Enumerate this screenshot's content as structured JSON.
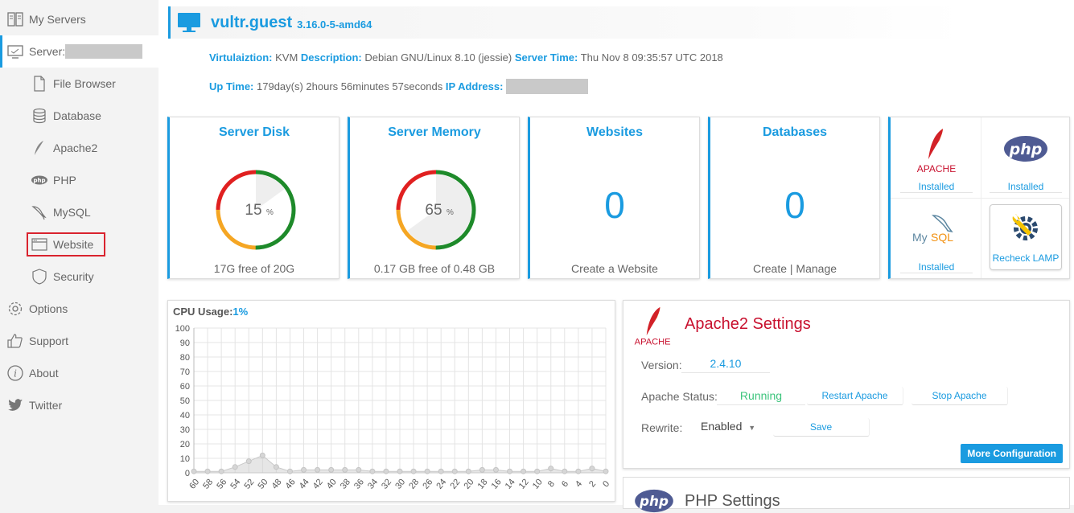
{
  "sidebar": {
    "my_servers": "My Servers",
    "server_label": "Server:",
    "file_browser": "File Browser",
    "database": "Database",
    "apache2": "Apache2",
    "php": "PHP",
    "mysql": "MySQL",
    "website": "Website",
    "security": "Security",
    "options": "Options",
    "support": "Support",
    "about": "About",
    "twitter": "Twitter"
  },
  "header": {
    "hostname": "vultr.guest",
    "kernel": "3.16.0-5-amd64"
  },
  "info": {
    "virt_label": "Virtulaiztion:",
    "virt_value": "KVM",
    "desc_label": "Description:",
    "desc_value": "Debian GNU/Linux 8.10 (jessie)",
    "time_label": "Server Time:",
    "time_value": "Thu Nov 8 09:35:57 UTC 2018",
    "uptime_label": "Up Time:",
    "uptime_value": "179day(s) 2hours 56minutes 57seconds",
    "ip_label": "IP Address:"
  },
  "cards": {
    "disk": {
      "title": "Server Disk",
      "percent": 15,
      "percent_text": "15",
      "unit": "%",
      "footer": "17G free of 20G"
    },
    "memory": {
      "title": "Server Memory",
      "percent": 65,
      "percent_text": "65",
      "unit": "%",
      "footer": "0.17 GB free of 0.48 GB"
    },
    "websites": {
      "title": "Websites",
      "count": "0",
      "footer": "Create a Website"
    },
    "databases": {
      "title": "Databases",
      "count": "0",
      "create": "Create",
      "sep": " | ",
      "manage": "Manage"
    }
  },
  "lamp": {
    "apache_logo": "APACHE",
    "apache_status": "Installed",
    "php_logo": "php",
    "php_status": "Installed",
    "mysql_logo_a": "My",
    "mysql_logo_b": "SQL",
    "mysql_status": "Installed",
    "recheck": "Recheck LAMP"
  },
  "cpu": {
    "label": "CPU Usage:",
    "value": "1%"
  },
  "chart_data": {
    "type": "area",
    "ylim": [
      0,
      100
    ],
    "yticks": [
      0,
      10,
      20,
      30,
      40,
      50,
      60,
      70,
      80,
      90,
      100
    ],
    "x": [
      60,
      58,
      56,
      54,
      52,
      50,
      48,
      46,
      44,
      42,
      40,
      38,
      36,
      34,
      32,
      30,
      28,
      26,
      24,
      22,
      20,
      18,
      16,
      14,
      12,
      10,
      8,
      6,
      4,
      2,
      0
    ],
    "values": [
      1,
      1,
      1,
      4,
      8,
      12,
      4,
      1,
      2,
      2,
      2,
      2,
      2,
      1,
      1,
      1,
      1,
      1,
      1,
      1,
      1,
      2,
      2,
      1,
      1,
      1,
      3,
      1,
      1,
      3,
      1
    ],
    "grid": true
  },
  "apache": {
    "logo": "APACHE",
    "title": "Apache2 Settings",
    "version_label": "Version:",
    "version_value": "2.4.10",
    "status_label": "Apache Status:",
    "status_value": "Running",
    "restart": "Restart Apache",
    "stop": "Stop Apache",
    "rewrite_label": "Rewrite:",
    "rewrite_value": "Enabled",
    "save": "Save",
    "more": "More Configuration"
  },
  "php_panel": {
    "logo": "php",
    "title": "PHP Settings"
  },
  "colors": {
    "accent": "#1a9be0",
    "gauge_red": "#e02020",
    "gauge_orange": "#f5a623",
    "gauge_green": "#1e8a2a",
    "running": "#3cc47c"
  }
}
